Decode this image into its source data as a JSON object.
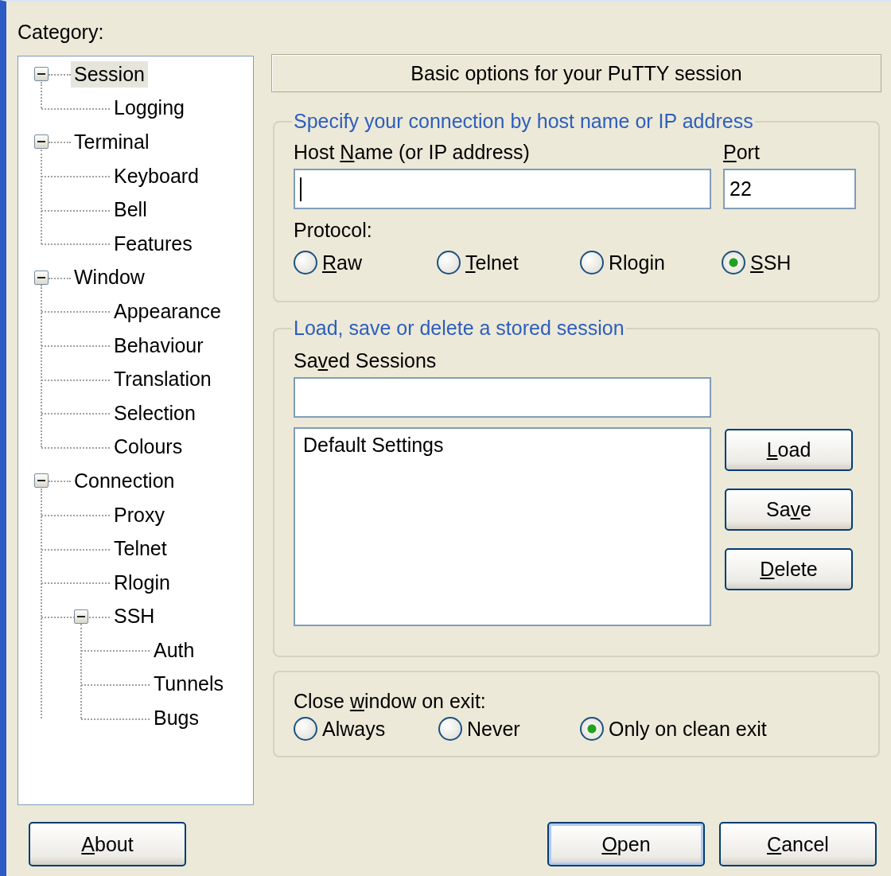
{
  "category_label": {
    "text": "Category:"
  },
  "tree": [
    {
      "label": "Session",
      "selected": true,
      "expanded": true,
      "children": [
        {
          "label": "Logging",
          "selected": false
        }
      ]
    },
    {
      "label": "Terminal",
      "selected": false,
      "expanded": true,
      "children": [
        {
          "label": "Keyboard",
          "selected": false
        },
        {
          "label": "Bell",
          "selected": false
        },
        {
          "label": "Features",
          "selected": false
        }
      ]
    },
    {
      "label": "Window",
      "selected": false,
      "expanded": true,
      "children": [
        {
          "label": "Appearance",
          "selected": false
        },
        {
          "label": "Behaviour",
          "selected": false
        },
        {
          "label": "Translation",
          "selected": false
        },
        {
          "label": "Selection",
          "selected": false
        },
        {
          "label": "Colours",
          "selected": false
        }
      ]
    },
    {
      "label": "Connection",
      "selected": false,
      "expanded": true,
      "children": [
        {
          "label": "Proxy",
          "selected": false
        },
        {
          "label": "Telnet",
          "selected": false
        },
        {
          "label": "Rlogin",
          "selected": false
        },
        {
          "label": "SSH",
          "selected": false,
          "expanded": true,
          "children": [
            {
              "label": "Auth",
              "selected": false
            },
            {
              "label": "Tunnels",
              "selected": false
            },
            {
              "label": "Bugs",
              "selected": false
            }
          ]
        }
      ]
    }
  ],
  "header": "Basic options for your PuTTY session",
  "connection_group": {
    "title": "Specify your connection by host name or IP address",
    "host": {
      "label": {
        "pre": "Host ",
        "key": "N",
        "post": "ame (or IP address)"
      },
      "focused": true
    },
    "port": {
      "label": {
        "key": "P",
        "post": "ort"
      },
      "value": "22"
    },
    "protocol_label": {
      "text": "Protocol:"
    },
    "protocols": [
      {
        "label": {
          "key": "R",
          "post": "aw"
        },
        "selected": false
      },
      {
        "label": {
          "key": "T",
          "post": "elnet"
        },
        "selected": false
      },
      {
        "label": {
          "text": "Rlogin"
        },
        "selected": false
      },
      {
        "label": {
          "key": "S",
          "post": "SH"
        },
        "selected": true
      }
    ]
  },
  "sessions_group": {
    "title": "Load, save or delete a stored session",
    "saved_label": {
      "pre": "Sa",
      "key": "v",
      "post": "ed Sessions"
    },
    "sessions": [
      {
        "label": "Default Settings",
        "selected": false
      }
    ],
    "buttons": [
      {
        "key": "L",
        "post": "oad"
      },
      {
        "pre": "Sa",
        "key": "v",
        "post": "e"
      },
      {
        "key": "D",
        "post": "elete"
      }
    ]
  },
  "exit_group": {
    "label": {
      "pre": "Close ",
      "key": "w",
      "post": "indow on exit:"
    },
    "options": [
      {
        "label": {
          "text": "Always"
        },
        "selected": false
      },
      {
        "label": {
          "text": "Never"
        },
        "selected": false
      },
      {
        "label": {
          "text": "Only on clean exit"
        },
        "selected": true
      }
    ]
  },
  "buttons": [
    {
      "label": {
        "key": "A",
        "post": "bout"
      },
      "default": false
    },
    {
      "label": {
        "key": "O",
        "post": "pen"
      },
      "default": true
    },
    {
      "label": {
        "key": "C",
        "post": "ancel"
      },
      "default": false
    }
  ]
}
